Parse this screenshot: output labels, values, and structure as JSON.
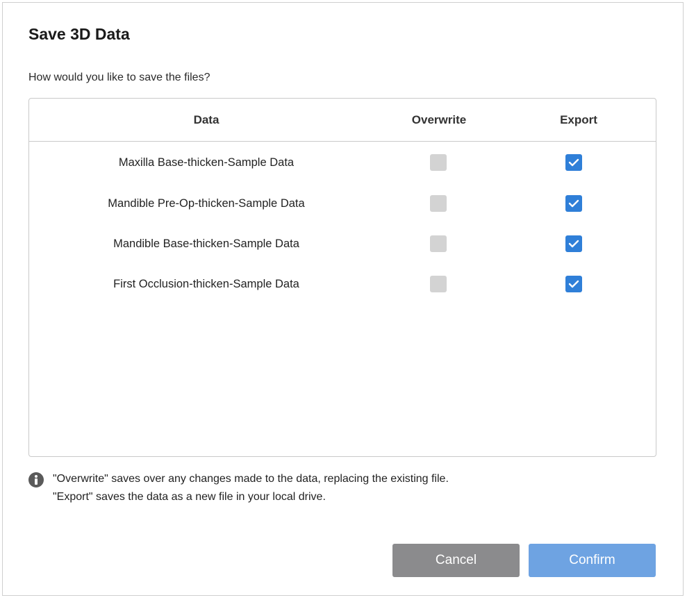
{
  "dialog": {
    "title": "Save 3D Data",
    "prompt": "How would you like to save the files?"
  },
  "table": {
    "columns": {
      "data": "Data",
      "overwrite": "Overwrite",
      "export": "Export"
    },
    "rows": [
      {
        "label": "Maxilla Base-thicken-Sample Data",
        "overwrite": false,
        "export": true
      },
      {
        "label": "Mandible Pre-Op-thicken-Sample Data",
        "overwrite": false,
        "export": true
      },
      {
        "label": "Mandible Base-thicken-Sample Data",
        "overwrite": false,
        "export": true
      },
      {
        "label": "First Occlusion-thicken-Sample Data",
        "overwrite": false,
        "export": true
      }
    ]
  },
  "info": {
    "icon": "info-icon",
    "line1": "\"Overwrite\" saves over any changes made to the data, replacing the existing file.",
    "line2": "\"Export\" saves the data as a new file in your local drive."
  },
  "buttons": {
    "cancel": "Cancel",
    "confirm": "Confirm"
  },
  "colors": {
    "checked": "#2f7fd8",
    "disabled_checkbox": "#d3d3d3",
    "cancel_button": "#8b8b8d",
    "confirm_button": "#6ea3e2"
  }
}
